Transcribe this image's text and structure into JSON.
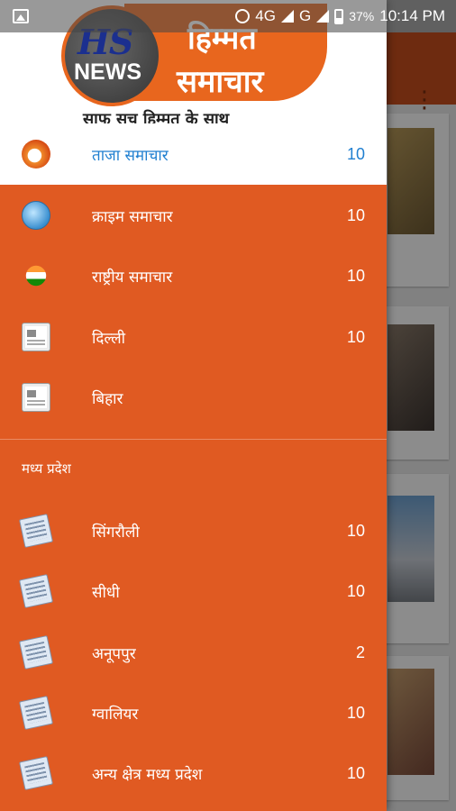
{
  "status_bar": {
    "network_1": "4G",
    "network_2": "G",
    "battery": "37%",
    "time": "10:14 PM"
  },
  "header": {
    "logo_hs": "HS",
    "logo_news": "NEWS",
    "logo_title_line1": "हिम्मत",
    "logo_title_line2": "समाचार",
    "tagline": "साफ सच हिम्मत के साथ"
  },
  "menu": {
    "items": [
      {
        "label": "ताजा समाचार",
        "count": "10",
        "icon": "latest-news-globe-icon",
        "active": true
      },
      {
        "label": "क्राइम समाचार",
        "count": "10",
        "icon": "crime-globe-icon"
      },
      {
        "label": "राष्ट्रीय समाचार",
        "count": "10",
        "icon": "india-flag-icon"
      },
      {
        "label": "दिल्ली",
        "count": "10",
        "icon": "newspaper-icon"
      },
      {
        "label": "बिहार",
        "count": "",
        "icon": "newspaper-icon"
      }
    ],
    "section_title": "मध्य प्रदेश",
    "section_items": [
      {
        "label": "सिंगरौली",
        "count": "10",
        "icon": "newspaper-stack-icon"
      },
      {
        "label": "सीधी",
        "count": "10",
        "icon": "newspaper-stack-icon"
      },
      {
        "label": "अनूपपुर",
        "count": "2",
        "icon": "newspaper-stack-icon"
      },
      {
        "label": "ग्वालियर",
        "count": "10",
        "icon": "newspaper-stack-icon"
      },
      {
        "label": "अन्य क्षेत्र मध्य प्रदेश",
        "count": "10",
        "icon": "newspaper-stack-icon"
      }
    ]
  },
  "colors": {
    "drawer_bg": "#e05a22",
    "active_text": "#1f7fd0",
    "toolbar_bg": "#c94f1e"
  }
}
